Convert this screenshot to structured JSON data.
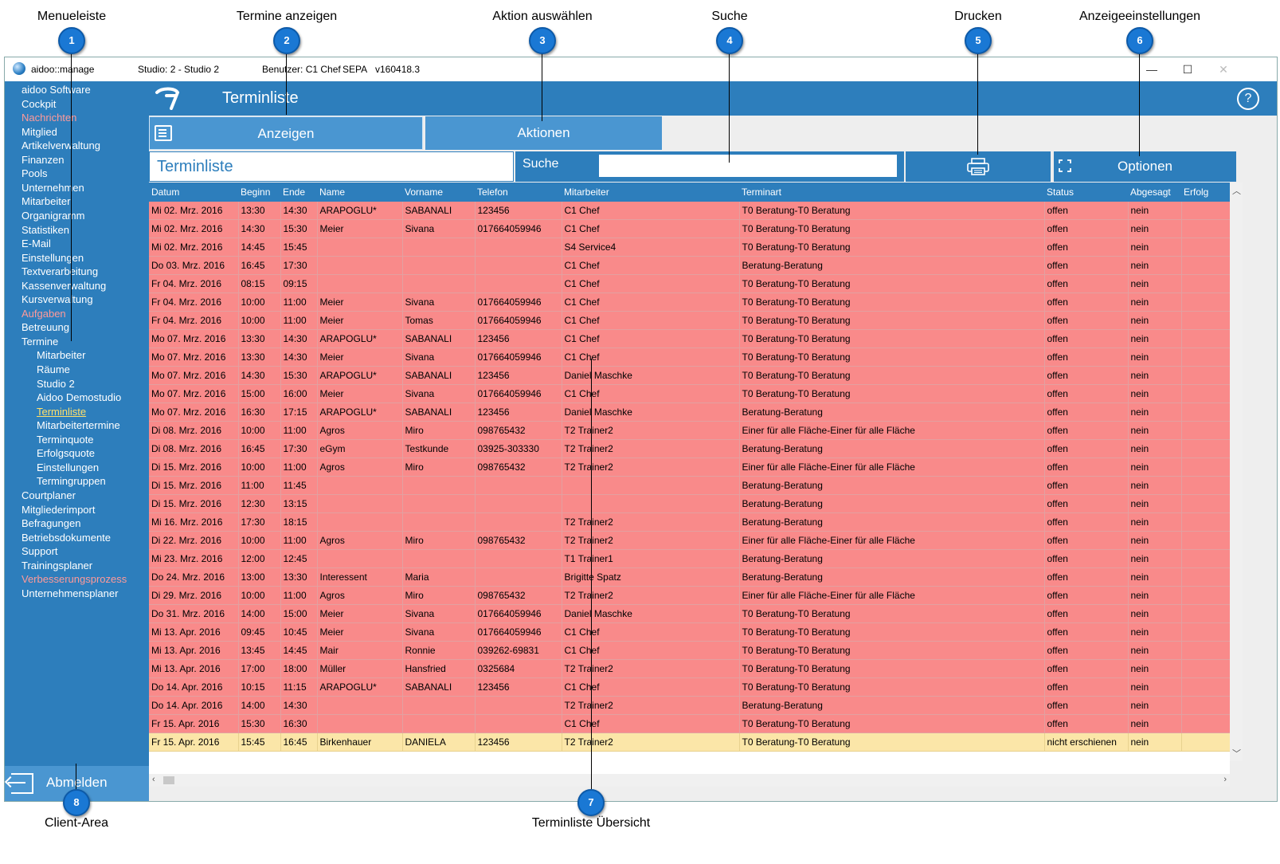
{
  "callouts": [
    {
      "label": "Menueleiste",
      "number": "1"
    },
    {
      "label": "Termine anzeigen",
      "number": "2"
    },
    {
      "label": "Aktion auswählen",
      "number": "3"
    },
    {
      "label": "Suche",
      "number": "4"
    },
    {
      "label": "Drucken",
      "number": "5"
    },
    {
      "label": "Anzeigeeinstellungen",
      "number": "6"
    },
    {
      "label": "Terminliste Übersicht",
      "number": "7"
    },
    {
      "label": "Client-Area",
      "number": "8"
    }
  ],
  "titlebar": {
    "app_name": "aidoo::manage",
    "studio": "Studio: 2 - Studio 2",
    "user": "Benutzer: C1 Chef",
    "sepa": "SEPA",
    "version": "v160418.3",
    "minimize": "—",
    "maximize": "☐",
    "close": "✕"
  },
  "sidebar": {
    "items": [
      {
        "label": "aidoo Software",
        "style": "normal",
        "indent": 0
      },
      {
        "label": "Cockpit",
        "style": "normal",
        "indent": 0
      },
      {
        "label": "Nachrichten",
        "style": "red",
        "indent": 0
      },
      {
        "label": "Mitglied",
        "style": "normal",
        "indent": 0
      },
      {
        "label": "Artikelverwaltung",
        "style": "normal",
        "indent": 0
      },
      {
        "label": "Finanzen",
        "style": "normal",
        "indent": 0
      },
      {
        "label": "Pools",
        "style": "normal",
        "indent": 0
      },
      {
        "label": "Unternehmen",
        "style": "normal",
        "indent": 0
      },
      {
        "label": "Mitarbeiter",
        "style": "normal",
        "indent": 0
      },
      {
        "label": "Organigramm",
        "style": "normal",
        "indent": 0
      },
      {
        "label": "Statistiken",
        "style": "normal",
        "indent": 0
      },
      {
        "label": "E-Mail",
        "style": "normal",
        "indent": 0
      },
      {
        "label": "Einstellungen",
        "style": "normal",
        "indent": 0
      },
      {
        "label": "Textverarbeitung",
        "style": "normal",
        "indent": 0
      },
      {
        "label": "Kassenverwaltung",
        "style": "normal",
        "indent": 0
      },
      {
        "label": "Kursverwaltung",
        "style": "normal",
        "indent": 0
      },
      {
        "label": "Aufgaben",
        "style": "red",
        "indent": 0
      },
      {
        "label": "Betreuung",
        "style": "normal",
        "indent": 0
      },
      {
        "label": "Termine",
        "style": "normal",
        "indent": 0
      },
      {
        "label": "Mitarbeiter",
        "style": "normal",
        "indent": 1
      },
      {
        "label": "Räume",
        "style": "normal",
        "indent": 1
      },
      {
        "label": "Studio 2",
        "style": "normal",
        "indent": 1
      },
      {
        "label": "Aidoo Demostudio",
        "style": "normal",
        "indent": 1
      },
      {
        "label": "Terminliste",
        "style": "active",
        "indent": 1
      },
      {
        "label": "Mitarbeitertermine",
        "style": "normal",
        "indent": 1
      },
      {
        "label": "Terminquote",
        "style": "normal",
        "indent": 1
      },
      {
        "label": "Erfolgsquote",
        "style": "normal",
        "indent": 1
      },
      {
        "label": "Einstellungen",
        "style": "normal",
        "indent": 1
      },
      {
        "label": "Termingruppen",
        "style": "normal",
        "indent": 1
      },
      {
        "label": "Courtplaner",
        "style": "normal",
        "indent": 0
      },
      {
        "label": "Mitgliederimport",
        "style": "normal",
        "indent": 0
      },
      {
        "label": "Befragungen",
        "style": "normal",
        "indent": 0
      },
      {
        "label": "Betriebsdokumente",
        "style": "normal",
        "indent": 0
      },
      {
        "label": "Support",
        "style": "normal",
        "indent": 0
      },
      {
        "label": "Trainingsplaner",
        "style": "normal",
        "indent": 0
      },
      {
        "label": "Verbesserungsprozess",
        "style": "red",
        "indent": 0
      },
      {
        "label": "Unternehmensplaner",
        "style": "normal",
        "indent": 0
      }
    ],
    "logout_label": "Abmelden"
  },
  "header": {
    "title": "Terminliste",
    "help": "?"
  },
  "tabs": {
    "show": "Anzeigen",
    "actions": "Aktionen"
  },
  "toolbar": {
    "list_title": "Terminliste",
    "search_label": "Suche",
    "search_value": "",
    "options_label": "Optionen"
  },
  "table": {
    "columns": [
      "Datum",
      "Beginn",
      "Ende",
      "Name",
      "Vorname",
      "Telefon",
      "Mitarbeiter",
      "Terminart",
      "Status",
      "Abgesagt",
      "Erfolg"
    ],
    "rows": [
      {
        "s": "red",
        "c": [
          "Mi 02. Mrz. 2016",
          "13:30",
          "14:30",
          "ARAPOGLU*",
          "SABANALI",
          "123456",
          "C1 Chef",
          "T0 Beratung-T0 Beratung",
          "offen",
          "nein",
          ""
        ]
      },
      {
        "s": "red",
        "c": [
          "Mi 02. Mrz. 2016",
          "14:30",
          "15:30",
          "Meier",
          "Sivana",
          "017664059946",
          "C1 Chef",
          "T0 Beratung-T0 Beratung",
          "offen",
          "nein",
          ""
        ]
      },
      {
        "s": "red",
        "c": [
          "Mi 02. Mrz. 2016",
          "14:45",
          "15:45",
          "",
          "",
          "",
          "S4 Service4",
          "T0 Beratung-T0 Beratung",
          "offen",
          "nein",
          ""
        ]
      },
      {
        "s": "red",
        "c": [
          "Do 03. Mrz. 2016",
          "16:45",
          "17:30",
          "",
          "",
          "",
          "C1 Chef",
          "Beratung-Beratung",
          "offen",
          "nein",
          ""
        ]
      },
      {
        "s": "red",
        "c": [
          "Fr 04. Mrz. 2016",
          "08:15",
          "09:15",
          "",
          "",
          "",
          "C1 Chef",
          "T0 Beratung-T0 Beratung",
          "offen",
          "nein",
          ""
        ]
      },
      {
        "s": "red",
        "c": [
          "Fr 04. Mrz. 2016",
          "10:00",
          "11:00",
          "Meier",
          "Sivana",
          "017664059946",
          "C1 Chef",
          "T0 Beratung-T0 Beratung",
          "offen",
          "nein",
          ""
        ]
      },
      {
        "s": "red",
        "c": [
          "Fr 04. Mrz. 2016",
          "10:00",
          "11:00",
          "Meier",
          "Tomas",
          "017664059946",
          "C1 Chef",
          "T0 Beratung-T0 Beratung",
          "offen",
          "nein",
          ""
        ]
      },
      {
        "s": "red",
        "c": [
          "Mo 07. Mrz. 2016",
          "13:30",
          "14:30",
          "ARAPOGLU*",
          "SABANALI",
          "123456",
          "C1 Chef",
          "T0 Beratung-T0 Beratung",
          "offen",
          "nein",
          ""
        ]
      },
      {
        "s": "red",
        "c": [
          "Mo 07. Mrz. 2016",
          "13:30",
          "14:30",
          "Meier",
          "Sivana",
          "017664059946",
          "C1 Chef",
          "T0 Beratung-T0 Beratung",
          "offen",
          "nein",
          ""
        ]
      },
      {
        "s": "red",
        "c": [
          "Mo 07. Mrz. 2016",
          "14:30",
          "15:30",
          "ARAPOGLU*",
          "SABANALI",
          "123456",
          "Daniel Maschke",
          "T0 Beratung-T0 Beratung",
          "offen",
          "nein",
          ""
        ]
      },
      {
        "s": "red",
        "c": [
          "Mo 07. Mrz. 2016",
          "15:00",
          "16:00",
          "Meier",
          "Sivana",
          "017664059946",
          "C1 Chef",
          "T0 Beratung-T0 Beratung",
          "offen",
          "nein",
          ""
        ]
      },
      {
        "s": "red",
        "c": [
          "Mo 07. Mrz. 2016",
          "16:30",
          "17:15",
          "ARAPOGLU*",
          "SABANALI",
          "123456",
          "Daniel Maschke",
          "Beratung-Beratung",
          "offen",
          "nein",
          ""
        ]
      },
      {
        "s": "red",
        "c": [
          "Di 08. Mrz. 2016",
          "10:00",
          "11:00",
          "Agros",
          "Miro",
          "098765432",
          "T2 Trainer2",
          "Einer für alle Fläche-Einer für alle Fläche",
          "offen",
          "nein",
          ""
        ]
      },
      {
        "s": "red",
        "c": [
          "Di 08. Mrz. 2016",
          "16:45",
          "17:30",
          "eGym",
          "Testkunde",
          "03925-303330",
          "T2 Trainer2",
          "Beratung-Beratung",
          "offen",
          "nein",
          ""
        ]
      },
      {
        "s": "red",
        "c": [
          "Di 15. Mrz. 2016",
          "10:00",
          "11:00",
          "Agros",
          "Miro",
          "098765432",
          "T2 Trainer2",
          "Einer für alle Fläche-Einer für alle Fläche",
          "offen",
          "nein",
          ""
        ]
      },
      {
        "s": "red",
        "c": [
          "Di 15. Mrz. 2016",
          "11:00",
          "11:45",
          "",
          "",
          "",
          "",
          "Beratung-Beratung",
          "offen",
          "nein",
          ""
        ]
      },
      {
        "s": "red",
        "c": [
          "Di 15. Mrz. 2016",
          "12:30",
          "13:15",
          "",
          "",
          "",
          "",
          "Beratung-Beratung",
          "offen",
          "nein",
          ""
        ]
      },
      {
        "s": "red",
        "c": [
          "Mi 16. Mrz. 2016",
          "17:30",
          "18:15",
          "",
          "",
          "",
          "T2 Trainer2",
          "Beratung-Beratung",
          "offen",
          "nein",
          ""
        ]
      },
      {
        "s": "red",
        "c": [
          "Di 22. Mrz. 2016",
          "10:00",
          "11:00",
          "Agros",
          "Miro",
          "098765432",
          "T2 Trainer2",
          "Einer für alle Fläche-Einer für alle Fläche",
          "offen",
          "nein",
          ""
        ]
      },
      {
        "s": "red",
        "c": [
          "Mi 23. Mrz. 2016",
          "12:00",
          "12:45",
          "",
          "",
          "",
          "T1 Trainer1",
          "Beratung-Beratung",
          "offen",
          "nein",
          ""
        ]
      },
      {
        "s": "red",
        "c": [
          "Do 24. Mrz. 2016",
          "13:00",
          "13:30",
          "Interessent",
          "Maria",
          "",
          "Brigitte Spatz",
          "Beratung-Beratung",
          "offen",
          "nein",
          ""
        ]
      },
      {
        "s": "red",
        "c": [
          "Di 29. Mrz. 2016",
          "10:00",
          "11:00",
          "Agros",
          "Miro",
          "098765432",
          "T2 Trainer2",
          "Einer für alle Fläche-Einer für alle Fläche",
          "offen",
          "nein",
          ""
        ]
      },
      {
        "s": "red",
        "c": [
          "Do 31. Mrz. 2016",
          "14:00",
          "15:00",
          "Meier",
          "Sivana",
          "017664059946",
          "Daniel Maschke",
          "T0 Beratung-T0 Beratung",
          "offen",
          "nein",
          ""
        ]
      },
      {
        "s": "red",
        "c": [
          "Mi 13. Apr. 2016",
          "09:45",
          "10:45",
          "Meier",
          "Sivana",
          "017664059946",
          "C1 Chef",
          "T0 Beratung-T0 Beratung",
          "offen",
          "nein",
          ""
        ]
      },
      {
        "s": "red",
        "c": [
          "Mi 13. Apr. 2016",
          "13:45",
          "14:45",
          "Mair",
          "Ronnie",
          "039262-69831",
          "C1 Chef",
          "T0 Beratung-T0 Beratung",
          "offen",
          "nein",
          ""
        ]
      },
      {
        "s": "red",
        "c": [
          "Mi 13. Apr. 2016",
          "17:00",
          "18:00",
          "Müller",
          "Hansfried",
          "0325684",
          "T2 Trainer2",
          "T0 Beratung-T0 Beratung",
          "offen",
          "nein",
          ""
        ]
      },
      {
        "s": "red",
        "c": [
          "Do 14. Apr. 2016",
          "10:15",
          "11:15",
          "ARAPOGLU*",
          "SABANALI",
          "123456",
          "C1 Chef",
          "T0 Beratung-T0 Beratung",
          "offen",
          "nein",
          ""
        ]
      },
      {
        "s": "red",
        "c": [
          "Do 14. Apr. 2016",
          "14:00",
          "14:30",
          "",
          "",
          "",
          "T2 Trainer2",
          "Beratung-Beratung",
          "offen",
          "nein",
          ""
        ]
      },
      {
        "s": "red",
        "c": [
          "Fr 15. Apr. 2016",
          "15:30",
          "16:30",
          "",
          "",
          "",
          "C1 Chef",
          "T0 Beratung-T0 Beratung",
          "offen",
          "nein",
          ""
        ]
      },
      {
        "s": "yellow",
        "c": [
          "Fr 15. Apr. 2016",
          "15:45",
          "16:45",
          "Birkenhauer",
          "DANIELA",
          "123456",
          "T2 Trainer2",
          "T0 Beratung-T0 Beratung",
          "nicht erschienen",
          "nein",
          ""
        ]
      }
    ]
  },
  "colors": {
    "brand": "#2d7ebc",
    "row_open": "#f98a8a",
    "row_noshow": "#fbe6a8",
    "badge": "#1a78d4"
  }
}
